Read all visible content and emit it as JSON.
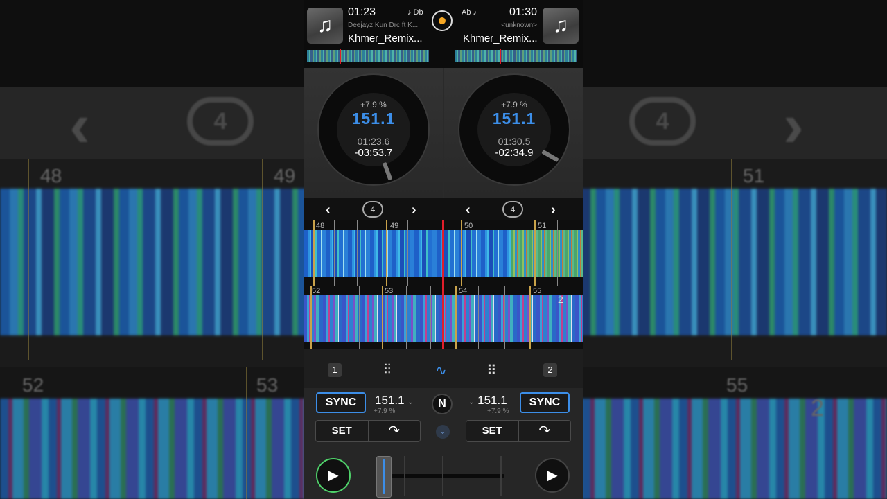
{
  "background": {
    "beat_numbers_top": [
      "48",
      "49",
      "51"
    ],
    "beat_numbers_bottom": [
      "52",
      "53",
      "55"
    ],
    "loop_count": "4",
    "deck_marker": "2"
  },
  "deck_left": {
    "time": "01:23",
    "key": "♪ Db",
    "artist": "Deejayz Kun Drc ft K...",
    "title": "Khmer_Remix...",
    "pitch": "+7.9 %",
    "bpm": "151.1",
    "elapsed": "01:23.6",
    "remaining": "-03:53.7",
    "loop_size": "4",
    "beats": [
      "48",
      "49",
      "50",
      "51"
    ]
  },
  "deck_right": {
    "time": "01:30",
    "key": "Ab ♪",
    "artist": "<unknown>",
    "title": "Khmer_Remix...",
    "pitch": "+7.9 %",
    "bpm": "151.1",
    "elapsed": "01:30.5",
    "remaining": "-02:34.9",
    "loop_size": "4",
    "beats": [
      "52",
      "53",
      "54",
      "55"
    ],
    "deck_label": "2"
  },
  "tabs": {
    "deck1": "1",
    "deck2": "2"
  },
  "controls": {
    "sync_label": "SYNC",
    "set_label": "SET",
    "left_bpm": "151.1",
    "left_pitch": "+7.9 %",
    "right_bpm": "151.1",
    "right_pitch": "+7.9 %",
    "logo": "N"
  },
  "colors": {
    "accent_blue": "#3c8ee8",
    "play_active": "#4fd26a",
    "record_dot": "#f5a623",
    "playhead": "#e01e2a"
  }
}
